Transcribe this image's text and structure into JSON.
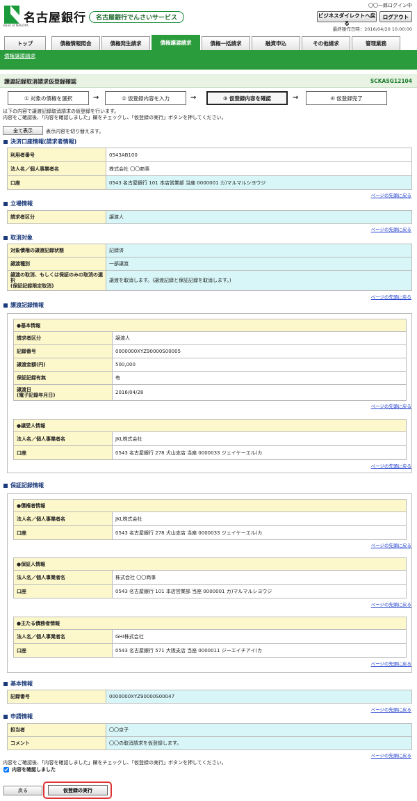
{
  "header": {
    "bank_name": "名古屋銀行",
    "logo_sub": "Bank of NAGOYA",
    "service": "名古屋銀行でんさいサービス",
    "login_user": "〇〇一郎ログイン中",
    "biz_direct_btn": "ビジネスダイレクトへ戻る",
    "logout_btn": "ログアウト",
    "last_op": "最終操作日時：2016/04/20 10:00:00"
  },
  "tabs": [
    "トップ",
    "債権情報照会",
    "債権発生請求",
    "債権譲渡請求",
    "債権一括請求",
    "融資申込",
    "その他請求",
    "管理業務"
  ],
  "active_tab": "債権譲渡請求",
  "subnav": "債権譲渡請求",
  "title": "譲渡記録取消請求仮登録確認",
  "screen_code": "SCKASG12104",
  "steps": [
    "① 対象の債権を選択",
    "② 仮登録内容を入力",
    "③ 仮登録内容を確認",
    "④ 仮登録完了"
  ],
  "arrow": "→",
  "msg1": "以下の内容で譲渡記録取消請求の仮登録を行います。",
  "msg2": "内容をご確認後、「内容を確認しました」欄をチェックし、「仮登録の実行」ボタンを押してください。",
  "show_all_btn": "全て表示",
  "show_all_note": "表示内容を切り替えます。",
  "page_top": "ページの先頭に戻る",
  "sections": {
    "account": {
      "title": "決済口座情報(請求者情報)",
      "rows": [
        [
          "利用者番号",
          "0543AB100"
        ],
        [
          "法人名／個人事業者名",
          "株式会社 〇〇商事"
        ],
        [
          "口座",
          "0543 名古屋銀行 101 本店営業部 当座 0000001 カ)マルマルシヨウジ"
        ]
      ]
    },
    "position": {
      "title": "立場情報",
      "rows": [
        [
          "請求者区分",
          "譲渡人"
        ]
      ]
    },
    "cancel": {
      "title": "取消対象",
      "rows": [
        [
          "対象債権の譲渡記録状態",
          "記録済"
        ],
        [
          "譲渡種別",
          "一部譲渡"
        ],
        [
          "譲渡の取消、もしくは保証のみの取消の選択\n(保証記録限定取消)",
          "譲渡を取消します。(譲渡記録と保証記録を取消します。)"
        ]
      ]
    },
    "transfer": {
      "title": "譲渡記録情報",
      "basic_head": "●基本情報",
      "basic_rows": [
        [
          "請求者区分",
          "譲渡人"
        ],
        [
          "記録番号",
          "0000000XYZ90000S00005"
        ],
        [
          "譲渡金額(円)",
          "500,000"
        ],
        [
          "保証記録有無",
          "有"
        ],
        [
          "譲渡日\n(電子記録年月日)",
          "2016/04/28"
        ]
      ],
      "receiver_head": "●譲受人情報",
      "receiver_rows": [
        [
          "法人名／個人事業者名",
          "JKL株式会社"
        ],
        [
          "口座",
          "0543 名古屋銀行 278 犬山支店 当座 0000033 ジェイケーエル(カ"
        ]
      ]
    },
    "guarantee": {
      "title": "保証記録情報",
      "creditor_head": "●債権者情報",
      "creditor_rows": [
        [
          "法人名／個人事業者名",
          "JKL株式会社"
        ],
        [
          "口座",
          "0543 名古屋銀行 278 犬山支店 当座 0000033 ジェイケーエル(カ"
        ]
      ],
      "guarantor_head": "●保証人情報",
      "guarantor_rows": [
        [
          "法人名／個人事業者名",
          "株式会社 〇〇商事"
        ],
        [
          "口座",
          "0543 名古屋銀行 101 本店営業部 当座 0000001 カ)マルマルシヨウジ"
        ]
      ],
      "debtor_head": "●主たる債務者情報",
      "debtor_rows": [
        [
          "法人名／個人事業者名",
          "GHI株式会社"
        ],
        [
          "口座",
          "0543 名古屋銀行 571 大阪支店 当座 0000011 ジーエイチアイ(カ"
        ]
      ]
    },
    "basic": {
      "title": "基本情報",
      "rows": [
        [
          "記録番号",
          "0000000XYZ90000S00047"
        ]
      ]
    },
    "request": {
      "title": "申請情報",
      "rows": [
        [
          "担当者",
          "〇〇京子"
        ],
        [
          "コメント",
          "〇〇の取消請求を仮登録します。"
        ]
      ]
    }
  },
  "confirm_msg": "内容をご確認後、「内容を確認しました」欄をチェックし、「仮登録の実行」ボタンを押してください。",
  "confirm_check": "内容を確認しました",
  "back_btn": "戻る",
  "exec_btn": "仮登録の実行"
}
